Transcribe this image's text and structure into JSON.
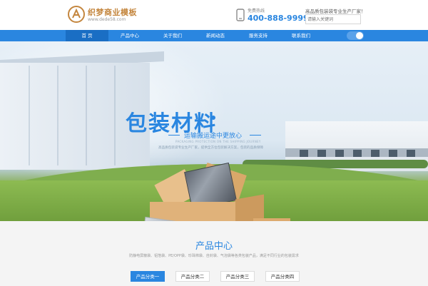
{
  "header": {
    "logo_title": "织梦商业模板",
    "logo_url": "www.dede58.com",
    "hotline_label": "免费热线",
    "hotline_number": "400-888-9999",
    "slogan": "高品质包装袋专业生产厂家！",
    "search_placeholder": "请输入关键词"
  },
  "nav": {
    "items": [
      {
        "label": "首 页",
        "active": true
      },
      {
        "label": "产品中心"
      },
      {
        "label": "关于我们"
      },
      {
        "label": "新闻动态"
      },
      {
        "label": "服务支持"
      },
      {
        "label": "联系我们"
      }
    ]
  },
  "banner": {
    "headline": "包装材料",
    "subheadline": "运输搬运途中更放心",
    "tagline_en": "PACKAGING PROTECTION ON THE SHIPPING JOURNEY",
    "tagline": "高品质包装袋专业生产厂家，提供全方位包装解决方案，包装的品质保障"
  },
  "products": {
    "title": "产品中心",
    "description": "防静电屏蔽袋、铝箔袋、PE/OPP袋、珍珠棉袋、自封袋、气泡袋等各类包装产品，满足不同行业的包装需求",
    "tabs": [
      {
        "label": "产品分类一",
        "active": true
      },
      {
        "label": "产品分类二"
      },
      {
        "label": "产品分类三"
      },
      {
        "label": "产品分类四"
      }
    ]
  },
  "colors": {
    "accent": "#2a86e0",
    "logo": "#c4863e"
  }
}
